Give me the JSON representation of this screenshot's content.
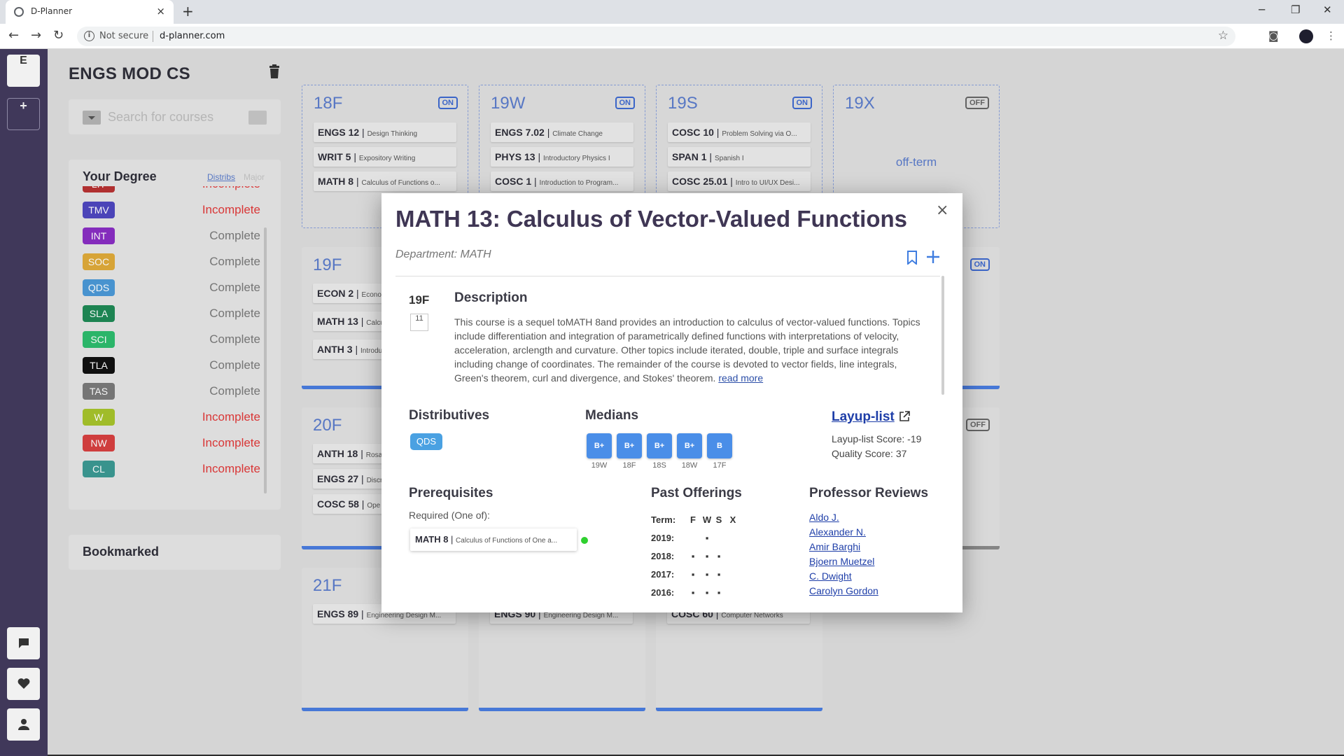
{
  "browser": {
    "tab_title": "D-Planner",
    "new_tab": "+",
    "tab_close": "×",
    "security": "Not secure",
    "url": "d-planner.com"
  },
  "rail": {
    "plan_initial": "E",
    "add": "+"
  },
  "planner": {
    "name": "ENGS MOD CS",
    "search_placeholder": "Search for courses"
  },
  "degree": {
    "title": "Your Degree",
    "tab_distribs": "Distribs",
    "tab_major": "Major",
    "items": [
      {
        "code": "LIT",
        "status": "Incomplete",
        "color": "#b83232"
      },
      {
        "code": "TMV",
        "status": "Incomplete",
        "color": "#4f47c0"
      },
      {
        "code": "INT",
        "status": "Complete",
        "color": "#8a2ec4"
      },
      {
        "code": "SOC",
        "status": "Complete",
        "color": "#e0ab3a"
      },
      {
        "code": "QDS",
        "status": "Complete",
        "color": "#4b9ad8"
      },
      {
        "code": "SLA",
        "status": "Complete",
        "color": "#1f8a56"
      },
      {
        "code": "SCI",
        "status": "Complete",
        "color": "#2dbd6e"
      },
      {
        "code": "TLA",
        "status": "Complete",
        "color": "#111111"
      },
      {
        "code": "TAS",
        "status": "Complete",
        "color": "#7a7a7a"
      },
      {
        "code": "W",
        "status": "Incomplete",
        "color": "#a7c42b"
      },
      {
        "code": "NW",
        "status": "Incomplete",
        "color": "#d84040"
      },
      {
        "code": "CL",
        "status": "Incomplete",
        "color": "#3c9a93"
      }
    ]
  },
  "bookmarked": {
    "title": "Bookmarked"
  },
  "terms": {
    "t18F": {
      "label": "18F",
      "flag": "ON",
      "courses": [
        {
          "code": "ENGS 12",
          "name": "Design Thinking"
        },
        {
          "code": "WRIT 5",
          "name": "Expository Writing"
        },
        {
          "code": "MATH 8",
          "name": "Calculus of Functions o..."
        }
      ]
    },
    "t19W": {
      "label": "19W",
      "flag": "ON",
      "courses": [
        {
          "code": "ENGS 7.02",
          "name": "Climate Change"
        },
        {
          "code": "PHYS 13",
          "name": "Introductory Physics I"
        },
        {
          "code": "COSC 1",
          "name": "Introduction to Program..."
        }
      ]
    },
    "t19S": {
      "label": "19S",
      "flag": "ON",
      "courses": [
        {
          "code": "COSC 10",
          "name": "Problem Solving via O..."
        },
        {
          "code": "SPAN 1",
          "name": "Spanish I"
        },
        {
          "code": "COSC 25.01",
          "name": "Intro to UI/UX Desi..."
        }
      ]
    },
    "t19X": {
      "label": "19X",
      "flag": "OFF",
      "note": "off-term"
    },
    "t19F": {
      "label": "19F",
      "courses": [
        {
          "code": "ECON 2",
          "name": "Econo"
        },
        {
          "code": "MATH 13",
          "name": "Calcu"
        },
        {
          "code": "ANTH 3",
          "name": "Introdu"
        }
      ]
    },
    "t20F": {
      "label": "20F",
      "courses": [
        {
          "code": "ANTH 18",
          "name": "Rosa"
        },
        {
          "code": "ENGS 27",
          "name": "Discr"
        },
        {
          "code": "COSC 58",
          "name": "Ope"
        }
      ]
    },
    "t21F": {
      "label": "21F",
      "courses": [
        {
          "code": "ENGS 89",
          "name": "Engineering Design M..."
        }
      ]
    },
    "t21W": {
      "courses": [
        {
          "code": "ENGS 90",
          "name": "Engineering Design M..."
        }
      ]
    },
    "t21S": {
      "courses": [
        {
          "code": "COSC 60",
          "name": "Computer Networks"
        }
      ]
    },
    "right_flags": {
      "mid": "ON",
      "lower": "OFF"
    }
  },
  "modal": {
    "title": "MATH 13: Calculus of Vector-Valued Functions",
    "department": "Department: MATH",
    "close": "×",
    "term": "19F",
    "term_count": "11",
    "description_title": "Description",
    "description": "This course is a sequel toMATH 8and provides an introduction to calculus of vector-valued functions. Topics include differentiation and integration of parametrically defined functions with interpretations of velocity, acceleration, arclength and curvature. Other topics include iterated, double, triple and surface integrals including change of coordinates. The remainder of the course is devoted to vector fields, line integrals, Green's theorem, curl and divergence, and Stokes' theorem.",
    "read_more": "read more",
    "distributives_title": "Distributives",
    "distributives": [
      "QDS"
    ],
    "medians_title": "Medians",
    "medians": [
      {
        "grade": "B+",
        "term": "19W"
      },
      {
        "grade": "B+",
        "term": "18F"
      },
      {
        "grade": "B+",
        "term": "18S"
      },
      {
        "grade": "B+",
        "term": "18W"
      },
      {
        "grade": "B",
        "term": "17F"
      }
    ],
    "layup_link": "Layup-list",
    "layup_score": "Layup-list Score: -19",
    "quality_score": "Quality Score: 37",
    "prereq_title": "Prerequisites",
    "prereq_required": "Required (One of):",
    "prereq_course": {
      "code": "MATH 8",
      "name": "Calculus of Functions of One a..."
    },
    "offerings_title": "Past Offerings",
    "offerings_header": {
      "term": "Term:",
      "cols": [
        "F",
        "W",
        "S",
        "X"
      ]
    },
    "offerings": [
      {
        "year": "2019:",
        "marks": [
          "",
          "▪",
          "",
          ""
        ]
      },
      {
        "year": "2018:",
        "marks": [
          "▪",
          "▪",
          "▪",
          ""
        ]
      },
      {
        "year": "2017:",
        "marks": [
          "▪",
          "▪",
          "▪",
          ""
        ]
      },
      {
        "year": "2016:",
        "marks": [
          "▪",
          "▪",
          "▪",
          ""
        ]
      }
    ],
    "professors_title": "Professor Reviews",
    "professors": [
      "Aldo J.",
      "Alexander N.",
      "Amir Barghi",
      "Bjoern Muetzel",
      "C. Dwight",
      "Carolyn Gordon"
    ]
  }
}
